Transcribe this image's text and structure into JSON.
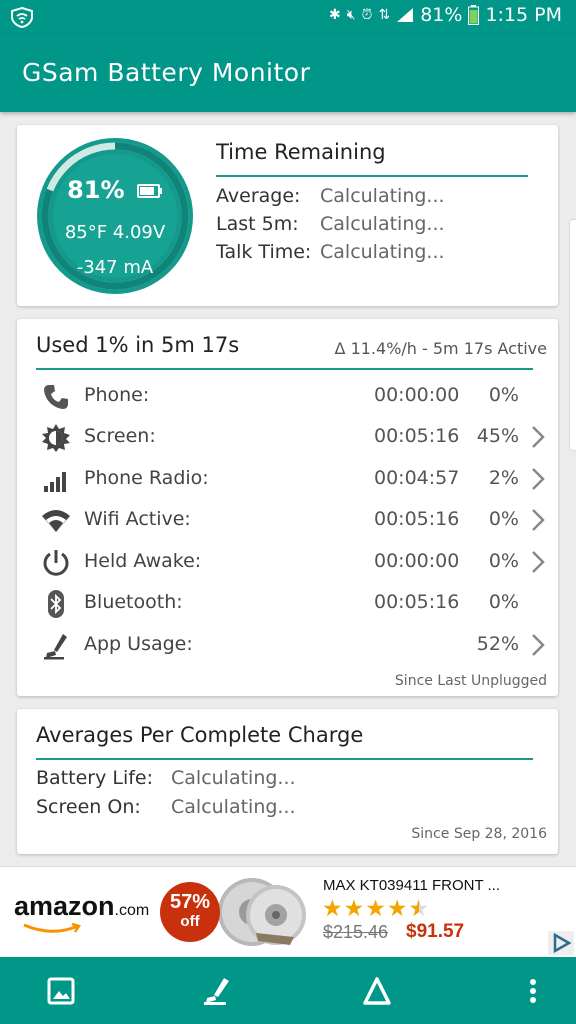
{
  "status_bar": {
    "battery": "81%",
    "time": "1:15 PM",
    "icons": [
      "wifi-icon",
      "bluetooth-icon",
      "mute-icon",
      "alarm-icon",
      "data-icon",
      "signal-icon",
      "battery-icon"
    ]
  },
  "app": {
    "title": "GSam Battery Monitor",
    "accent": "#009688"
  },
  "gauge": {
    "percent": "81%",
    "temp_voltage": "85°F  4.09V",
    "current": "-347 mA",
    "level": 0.81
  },
  "time_remaining": {
    "title": "Time Remaining",
    "rows": [
      {
        "label": "Average:",
        "value": "Calculating..."
      },
      {
        "label": "Last 5m:",
        "value": "Calculating..."
      },
      {
        "label": "Talk Time:",
        "value": "Calculating..."
      }
    ]
  },
  "usage": {
    "title": "Used 1% in 5m 17s",
    "rate": "Δ 11.4%/h - 5m 17s Active",
    "rows": [
      {
        "label": "Phone:",
        "time": "00:00:00",
        "pct": "0%",
        "icon": "phone-icon"
      },
      {
        "label": "Screen:",
        "time": "00:05:16",
        "pct": "45%",
        "icon": "brightness-icon"
      },
      {
        "label": "Phone Radio:",
        "time": "00:04:57",
        "pct": "2%",
        "icon": "signal-bars-icon"
      },
      {
        "label": "Wifi Active:",
        "time": "00:05:16",
        "pct": "0%",
        "icon": "wifi-icon"
      },
      {
        "label": "Held Awake:",
        "time": "00:00:00",
        "pct": "0%",
        "icon": "power-icon"
      },
      {
        "label": "Bluetooth:",
        "time": "00:05:16",
        "pct": "0%",
        "icon": "bluetooth-icon"
      },
      {
        "label": "App Usage:",
        "time": "",
        "pct": "52%",
        "icon": "app-usage-icon"
      }
    ],
    "footer": "Since Last Unplugged"
  },
  "averages": {
    "title": "Averages Per Complete Charge",
    "rows": [
      {
        "label": "Battery Life:",
        "value": "Calculating..."
      },
      {
        "label": "Screen On:",
        "value": "Calculating..."
      }
    ],
    "footer": "Since Sep 28, 2016"
  },
  "ad": {
    "brand": "amazon",
    "brand_suffix": ".com",
    "discount": "57%",
    "discount_label": "off",
    "product": "MAX KT039411 FRONT ...",
    "rating": 4.5,
    "old_price": "$215.46",
    "new_price": "$91.57"
  },
  "bottom_bar": {
    "icons": [
      "image-icon",
      "app-usage-icon",
      "delta-icon",
      "more-vert-icon"
    ]
  }
}
